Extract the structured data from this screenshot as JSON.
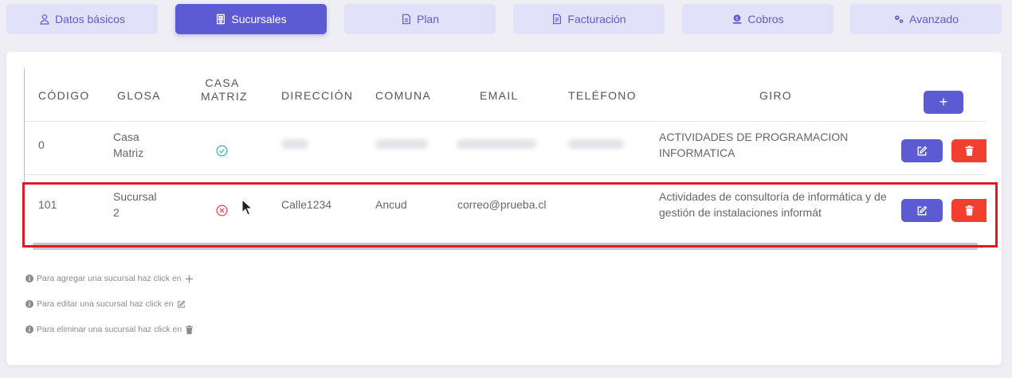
{
  "tabs": [
    {
      "label": "Datos básicos",
      "icon": "user-icon",
      "active": false
    },
    {
      "label": "Sucursales",
      "icon": "building-icon",
      "active": true
    },
    {
      "label": "Plan",
      "icon": "document-icon",
      "active": false
    },
    {
      "label": "Facturación",
      "icon": "invoice-icon",
      "active": false
    },
    {
      "label": "Cobros",
      "icon": "money-icon",
      "active": false
    },
    {
      "label": "Avanzado",
      "icon": "gears-icon",
      "active": false
    }
  ],
  "table": {
    "headers": {
      "codigo": "CÓDIGO",
      "glosa": "GLOSA",
      "casa_matriz_1": "CASA",
      "casa_matriz_2": "MATRIZ",
      "direccion": "DIRECCIÓN",
      "comuna": "COMUNA",
      "email": "EMAIL",
      "telefono": "TELÉFONO",
      "giro": "GIRO"
    },
    "add_button_label": "+",
    "rows": [
      {
        "codigo": "0",
        "glosa_1": "Casa",
        "glosa_2": "Matriz",
        "casa_matriz": true,
        "direccion": "",
        "comuna": "",
        "email": "",
        "telefono": "",
        "giro_1": "ACTIVIDADES DE PROGRAMACION",
        "giro_2": "INFORMATICA"
      },
      {
        "codigo": "101",
        "glosa_1": "Sucursal",
        "glosa_2": "2",
        "casa_matriz": false,
        "direccion": "Calle1234",
        "comuna": "Ancud",
        "email": "correo@prueba.cl",
        "telefono": "",
        "giro_1": "Actividades de consultoría de informática y de",
        "giro_2": "gestión de instalaciones informát"
      }
    ]
  },
  "hints": {
    "add": "Para agregar una sucursal haz click en",
    "edit": "Para editar una sucursal haz click en",
    "delete": "Para eliminar una sucursal haz click en"
  },
  "colors": {
    "accent": "#5d5bd4",
    "tab_inactive_bg": "#e2e1fa",
    "danger": "#f1402f",
    "success": "#3bb89a",
    "highlight": "#e11a27"
  }
}
